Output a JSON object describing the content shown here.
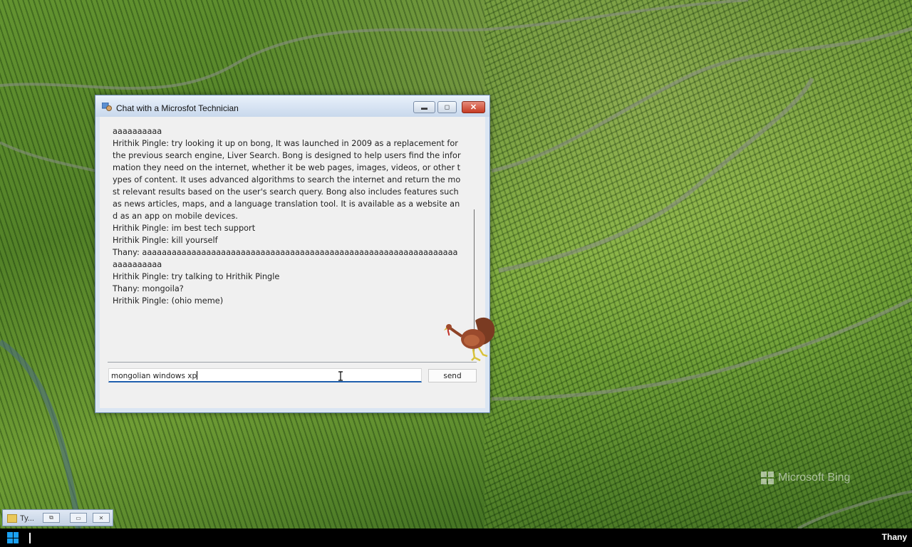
{
  "window": {
    "title": "Chat with a Microsfot Technician",
    "minimize_glyph": "▬",
    "maximize_glyph": "◻",
    "close_glyph": "✕"
  },
  "chat": {
    "messages": [
      "aaaa",
      "Thany: aaaaaaaaaaaaaaaaaaaaaaaaaaaaaaaaaaaaaaaaaaaaaaaaaaaaaaaaaaaaaaaaaaaaaaaaaa",
      "Hrithik Pingle: try looking it up on bong, It was launched in 2009 as a replacement for the previous search engine, Liver Search. Bong is designed to help users find the information they need on the internet, whether it be web pages, images, videos, or other types of content. It uses advanced algorithms to search the internet and return the most relevant results based on the user's search query. Bong also includes features such as news articles, maps, and a language translation tool. It is available as a website and as an app on mobile devices.",
      "Hrithik Pingle: im best tech support",
      "Hrithik Pingle: kill yourself",
      "Thany: aaaaaaaaaaaaaaaaaaaaaaaaaaaaaaaaaaaaaaaaaaaaaaaaaaaaaaaaaaaaaaaaaaaaaaaaaa",
      "Hrithik Pingle: try talking to Hrithik Pingle",
      "Thany: mongoila?",
      "Hrithik Pingle: (ohio meme)"
    ],
    "input_value": "mongolian windows xp",
    "send_label": "send"
  },
  "minimized": {
    "title": "Ty..."
  },
  "watermark": {
    "text": "Microsoft Bing"
  },
  "taskbar": {
    "user": "Thany",
    "accent": "#1aa1f2"
  }
}
